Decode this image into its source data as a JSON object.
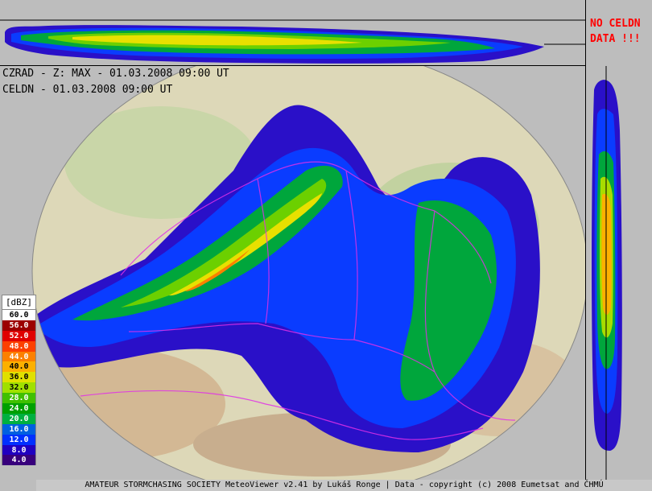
{
  "info": {
    "line1": "CZRAD - Z: MAX - 01.03.2008 09:00 UT",
    "line2": "CELDN - 01.03.2008 09:00 UT"
  },
  "warning": "NO CELDN\nDATA !!!",
  "legend": {
    "title": "[dBZ]",
    "levels": [
      {
        "label": "60.0",
        "color": "#ffffff"
      },
      {
        "label": "56.0",
        "color": "#9c0000"
      },
      {
        "label": "52.0",
        "color": "#e00000"
      },
      {
        "label": "48.0",
        "color": "#fc4000"
      },
      {
        "label": "44.0",
        "color": "#fc8000"
      },
      {
        "label": "40.0",
        "color": "#fcb000"
      },
      {
        "label": "36.0",
        "color": "#e0e000"
      },
      {
        "label": "32.0",
        "color": "#a0e000"
      },
      {
        "label": "28.0",
        "color": "#40c000"
      },
      {
        "label": "24.0",
        "color": "#00a000"
      },
      {
        "label": "20.0",
        "color": "#00b040"
      },
      {
        "label": "16.0",
        "color": "#0060e0"
      },
      {
        "label": "12.0",
        "color": "#0030ff"
      },
      {
        "label": "8.0",
        "color": "#2000c0"
      },
      {
        "label": "4.0",
        "color": "#38007c"
      }
    ]
  },
  "footer": "AMATEUR STORMCHASING SOCIETY MeteoViewer v2.41 by Lukáš Ronge | Data - copyright (c) 2008 Eumetsat and ČHMÚ"
}
